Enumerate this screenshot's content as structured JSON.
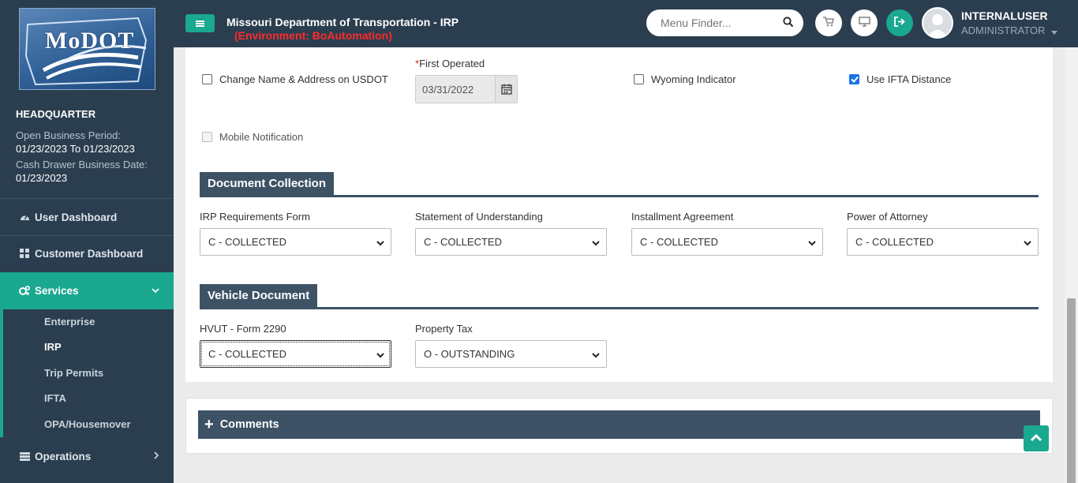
{
  "sidebar": {
    "logo_text": "MoDOT",
    "office": "HEADQUARTER",
    "open_business_period_label": "Open Business Period:",
    "open_business_period_value": "01/23/2023 To 01/23/2023",
    "cash_drawer_label": "Cash Drawer Business Date:",
    "cash_drawer_value": "01/23/2023",
    "nav": [
      {
        "label": "User Dashboard",
        "icon": "dashboard-icon"
      },
      {
        "label": "Customer Dashboard",
        "icon": "grid-icon"
      },
      {
        "label": "Services",
        "icon": "cogs-icon",
        "active": true
      },
      {
        "label": "Operations",
        "icon": "server-icon"
      }
    ],
    "sub_items": [
      {
        "label": "Enterprise"
      },
      {
        "label": "IRP",
        "current": true
      },
      {
        "label": "Trip Permits"
      },
      {
        "label": "IFTA"
      },
      {
        "label": "OPA/Housemover"
      }
    ]
  },
  "header": {
    "title": "Missouri Department of Transportation - IRP",
    "environment": "(Environment: BoAutomation)",
    "search_placeholder": "Menu Finder...",
    "user_name": "INTERNALUSER",
    "user_role": "ADMINISTRATOR"
  },
  "form": {
    "change_name_address_label": "Change Name & Address on USDOT",
    "change_name_address_checked": false,
    "first_operated_label": "First Operated",
    "first_operated_required_mark": "*",
    "first_operated_value": "03/31/2022",
    "wyoming_label": "Wyoming Indicator",
    "wyoming_checked": false,
    "ifta_distance_label": "Use IFTA Distance",
    "ifta_distance_checked": true,
    "mobile_notification_label": "Mobile Notification",
    "mobile_notification_disabled": true
  },
  "document_collection": {
    "title": "Document Collection",
    "fields": [
      {
        "label": "IRP Requirements Form",
        "value": "C - COLLECTED"
      },
      {
        "label": "Statement of Understanding",
        "value": "C - COLLECTED"
      },
      {
        "label": "Installment Agreement",
        "value": "C - COLLECTED"
      },
      {
        "label": "Power of Attorney",
        "value": "C - COLLECTED"
      }
    ]
  },
  "vehicle_document": {
    "title": "Vehicle Document",
    "fields": [
      {
        "label": "HVUT - Form 2290",
        "value": "C - COLLECTED"
      },
      {
        "label": "Property Tax",
        "value": "O - OUTSTANDING"
      }
    ]
  },
  "comments": {
    "plus": "+",
    "title": "Comments"
  },
  "colors": {
    "sidebar_bg": "#2b3e4f",
    "accent": "#1aa890",
    "section_bg": "#3e5266",
    "env_red": "#ff2a2a"
  }
}
